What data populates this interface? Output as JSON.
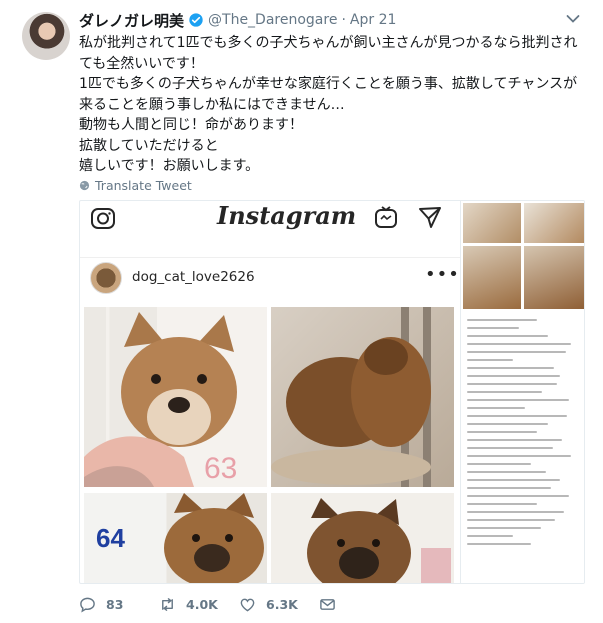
{
  "tweet": {
    "display_name": "ダレノガレ明美",
    "handle": "@The_Darenogare",
    "separator": "·",
    "date": "Apr 21",
    "lines": [
      "私が批判されて1匹でも多くの子犬ちゃんが飼い主さんが見つかるなら批判され",
      "ても全然いいです！",
      "1匹でも多くの子犬ちゃんが幸せな家庭行くことを願う事、拡散してチャンスが",
      "来ることを願う事しか私にはできません…",
      "動物も人間と同じ！命があります！",
      "拡散していただけると",
      "嬉しいです！お願いします。"
    ],
    "translate_label": "Translate Tweet",
    "media": {
      "instagram_logo": "Instagram",
      "instagram_user": "dog_cat_love2626",
      "more_label": "•••",
      "photo_numbers": [
        "63",
        "64"
      ]
    },
    "actions": {
      "replies": "83",
      "retweets": "4.0K",
      "likes": "6.3K"
    }
  },
  "colors": {
    "text": "#14171a",
    "secondary": "#657786",
    "verified": "#1da1f2"
  }
}
